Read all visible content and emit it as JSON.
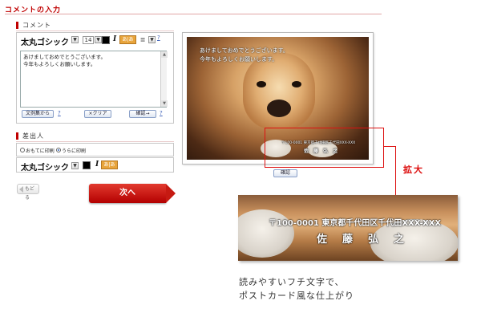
{
  "page": {
    "title": "コメントの入力"
  },
  "comment_section": {
    "heading": "コメント",
    "toolbar": {
      "font_name": "太丸ゴシック",
      "font_size": "14",
      "italic_label": "I",
      "help_mark": "?"
    },
    "textarea_value": "あけましておめでとうございます。\n今年もよろしくお願いします。",
    "buttons": {
      "samples": "文例集から",
      "clear": "×クリア",
      "confirm": "確認→"
    }
  },
  "sender_section": {
    "heading": "差出人",
    "radio_options": [
      {
        "label": "おもてに印刷",
        "selected": false
      },
      {
        "label": "うらに印刷",
        "selected": true
      }
    ],
    "toolbar": {
      "font_name": "太丸ゴシック",
      "italic_label": "I"
    }
  },
  "nav": {
    "back_label": "もどる",
    "next_label": "次へ"
  },
  "preview": {
    "greeting_lines": "あけましておめでとうございます。\n今年もよろしくお願いします。",
    "sender_address": "〒100-0001 東京都千代田区千代田XXX-XXX",
    "sender_name": "佐　藤　弘　之",
    "confirm_button": "確認",
    "zoom_label": "拡大"
  },
  "caption": "読みやすいフチ文字で、\nポストカード風な仕上がり",
  "colors": {
    "accent": "#c00000",
    "zoom_highlight": "#dd1111"
  }
}
